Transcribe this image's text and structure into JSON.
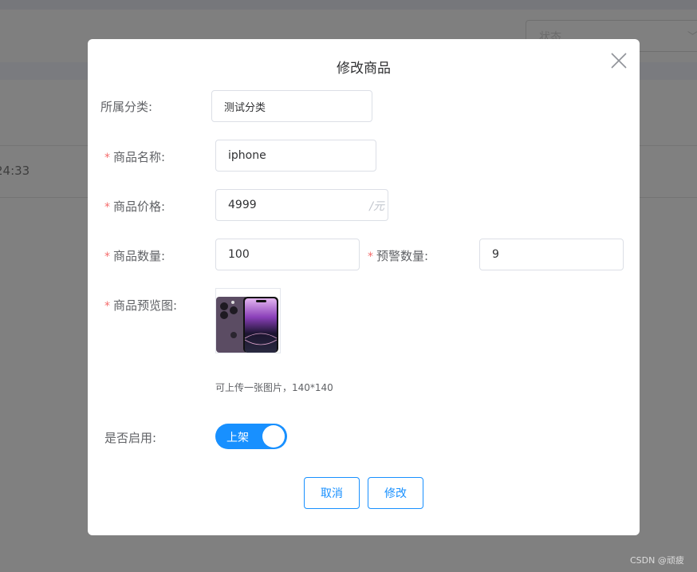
{
  "background": {
    "status_select_placeholder": "状态",
    "row_time_fragment": "24:33",
    "watermark": "CSDN @顽疲"
  },
  "dialog": {
    "title": "修改商品",
    "close_icon": "close-icon",
    "fields": {
      "category": {
        "label": "所属分类:",
        "value": "测试分类",
        "required": false
      },
      "name": {
        "label": "商品名称:",
        "value": "iphone",
        "required": true
      },
      "price": {
        "label": "商品价格:",
        "value": "4999",
        "suffix": "/元",
        "required": true
      },
      "quantity": {
        "label": "商品数量:",
        "value": "100",
        "required": true
      },
      "warning_quantity": {
        "label": "预警数量:",
        "value": "9",
        "required": true
      },
      "preview_image": {
        "label": "商品预览图:",
        "hint": "可上传一张图片，140*140",
        "required": true,
        "image_alt": "iphone preview"
      },
      "enabled": {
        "label": "是否启用:",
        "switch_text": "上架",
        "on": true
      }
    },
    "required_mark": "*",
    "buttons": {
      "cancel": "取消",
      "submit": "修改"
    }
  },
  "colors": {
    "primary": "#1890ff",
    "required": "#f56c6c",
    "overlay": "#808080"
  }
}
